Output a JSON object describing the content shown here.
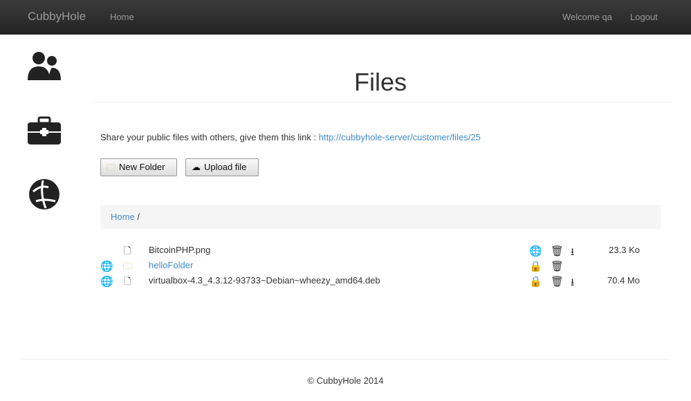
{
  "nav": {
    "brand": "CubbyHole",
    "home": "Home",
    "welcome": "Welcome qa",
    "logout": "Logout"
  },
  "page": {
    "title": "Files",
    "share_text": "Share your public files with others, give them this link : ",
    "share_link": "http://cubbyhole-server/customer/files/25",
    "new_folder": "New Folder",
    "upload": "Upload file"
  },
  "breadcrumb": {
    "home": "Home",
    "sep": "/"
  },
  "files": [
    {
      "name": "BitcoinPHP.png",
      "type": "file",
      "public": false,
      "size": "23.3 Ko"
    },
    {
      "name": "helloFolder",
      "type": "folder",
      "public": true,
      "size": ""
    },
    {
      "name": "virtualbox-4.3_4.3.12-93733~Debian~wheezy_amd64.deb",
      "type": "file",
      "public": true,
      "size": "70.4 Mo"
    }
  ],
  "footer": "© CubbyHole 2014"
}
